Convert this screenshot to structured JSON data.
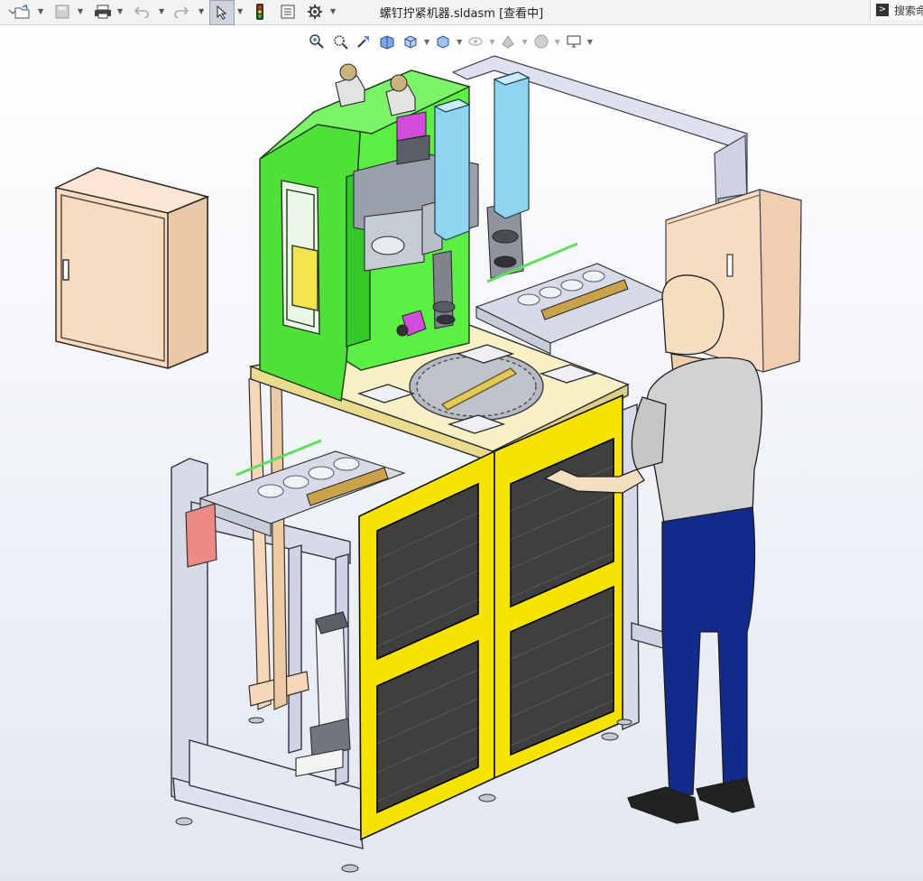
{
  "window": {
    "title": "螺钉拧紧机器.sldasm [查看中]"
  },
  "search": {
    "label": "搜索命"
  },
  "toolbar": {
    "icons": [
      "new-document-icon",
      "open-folder-icon",
      "save-icon",
      "print-icon",
      "undo-icon",
      "redo-icon",
      "select-arrow-icon",
      "traffic-light-icon",
      "properties-icon",
      "gear-icon"
    ]
  },
  "viewbar": {
    "icons": [
      "zoom-to-fit-icon",
      "zoom-area-icon",
      "previous-view-icon",
      "section-view-icon",
      "view-orientation-icon",
      "display-style-icon",
      "hide-show-icon",
      "edit-appearance-icon",
      "scene-icon",
      "view-settings-icon"
    ]
  },
  "model": {
    "name": "螺钉拧紧机器",
    "colors": {
      "frame": "#d7dbe8",
      "gantry": "#4fe13a",
      "panel": "#f6e300",
      "cabinet": "#f7dcc2",
      "cylinder": "#8fd5f2",
      "figureShirt": "#d2d2d2",
      "figurePants": "#112a8c",
      "figureSkin": "#f4dfc0"
    }
  }
}
